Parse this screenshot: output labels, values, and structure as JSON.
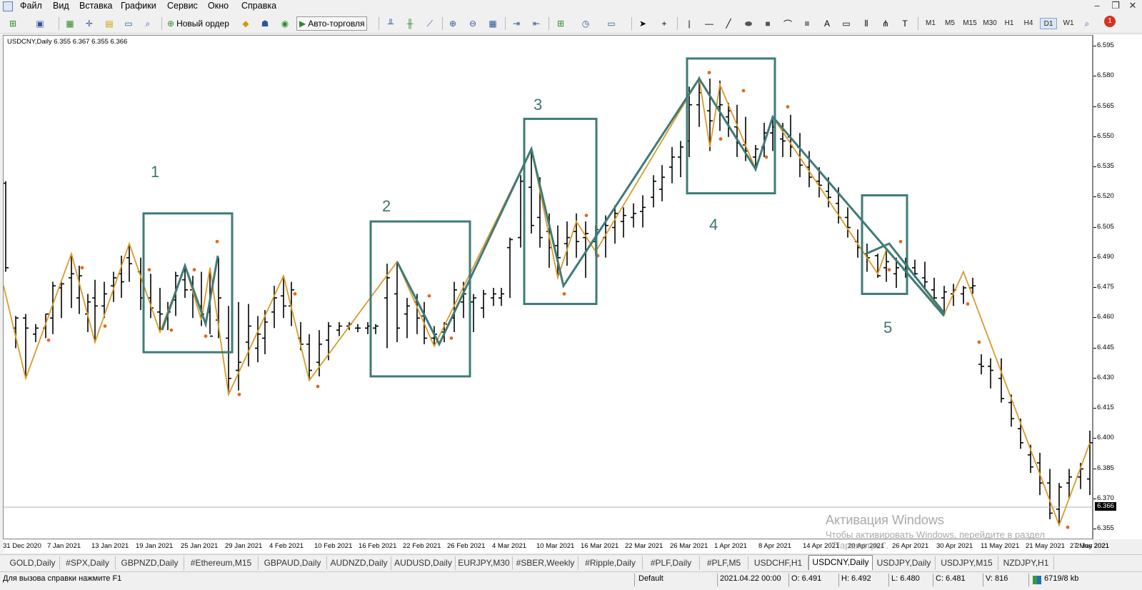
{
  "menu": [
    "Файл",
    "Вид",
    "Вставка",
    "Графики",
    "Сервис",
    "Окно",
    "Справка"
  ],
  "toolbar": {
    "new_order": "Новый ордер",
    "auto_trading": "Авто-торговля",
    "timeframes": [
      "M1",
      "M5",
      "M15",
      "M30",
      "H1",
      "H4",
      "D1",
      "W1",
      "MN"
    ],
    "active_timeframe": "D1",
    "notification_count": "1"
  },
  "chart": {
    "header": "USDCNY,Daily  6.355 6.367 6.355 6.366",
    "current_price": "6.366",
    "box_labels": [
      "1",
      "2",
      "3",
      "4",
      "5"
    ]
  },
  "chart_data": {
    "type": "ohlc-bars",
    "symbol": "USDCNY",
    "timeframe": "Daily",
    "y_ticks": [
      "6.595",
      "6.580",
      "6.565",
      "6.550",
      "6.535",
      "6.520",
      "6.505",
      "6.490",
      "6.475",
      "6.460",
      "6.445",
      "6.430",
      "6.415",
      "6.400",
      "6.385",
      "6.370",
      "6.355"
    ],
    "x_ticks": [
      "31 Dec 2020",
      "7 Jan 2021",
      "13 Jan 2021",
      "19 Jan 2021",
      "25 Jan 2021",
      "29 Jan 2021",
      "4 Feb 2021",
      "10 Feb 2021",
      "16 Feb 2021",
      "22 Feb 2021",
      "26 Feb 2021",
      "4 Mar 2021",
      "10 Mar 2021",
      "16 Mar 2021",
      "22 Mar 2021",
      "26 Mar 2021",
      "1 Apr 2021",
      "8 Apr 2021",
      "14 Apr 2021",
      "20 Apr 2021",
      "26 Apr 2021",
      "30 Apr 2021",
      "11 May 2021",
      "21 May 2021",
      "27 May 2021",
      "2 Jun 2021"
    ],
    "ylim": [
      6.35,
      6.6
    ],
    "last_close": 6.366
  },
  "tabs": [
    "GOLD,Daily",
    "#SPX,Daily",
    "GBPNZD,Daily",
    "#Ethereum,M15",
    "GBPAUD,Daily",
    "AUDNZD,Daily",
    "AUDUSD,Daily",
    "EURJPY,M30",
    "#SBER,Weekly",
    "#Ripple,Daily",
    "#PLF,Daily",
    "#PLF,M5",
    "USDCHF,H1",
    "USDCNY,Daily",
    "USDJPY,Daily",
    "USDJPY,M15",
    "NZDJPY,H1"
  ],
  "active_tab": "USDCNY,Daily",
  "status": {
    "help": "Для вызова справки нажмите F1",
    "profile": "Default",
    "datetime": "2021.04.22 00:00",
    "open": "O: 6.491",
    "high": "H: 6.492",
    "low": "L: 6.480",
    "close": "C: 6.481",
    "volume": "V: 816",
    "traffic": "6719/8 kb"
  },
  "watermark": {
    "title": "Активация Windows",
    "subtitle": "Чтобы активировать Windows, перейдите в раздел",
    "subtitle2": "\"Параметры\"."
  }
}
